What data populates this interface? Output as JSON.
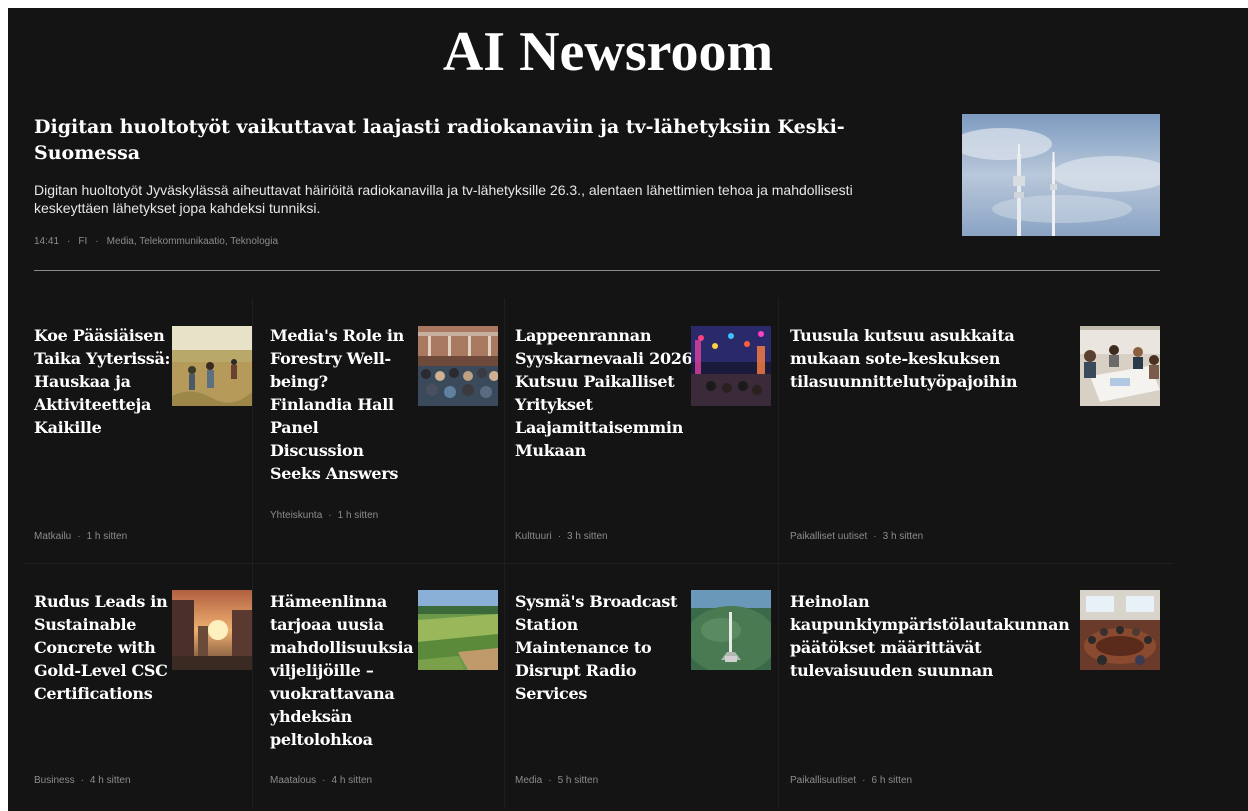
{
  "masthead": "AI Newsroom",
  "hero": {
    "title": "Digitan huoltotyöt vaikuttavat laajasti radiokanaviin ja tv-lähetyksiin Keski-Suomessa",
    "summary": "Digitan huoltotyöt Jyväskylässä aiheuttavat häiriöitä radiokanavilla ja tv-lähetyksille 26.3., alentaen lähettimien tehoa ja mahdollisesti keskeyttäen lähetykset jopa kahdeksi tunniksi.",
    "time": "14:41",
    "lang": "FI",
    "categories": "Media, Telekommunikaatio, Teknologia",
    "image": "radio-masts-photo"
  },
  "cards": [
    {
      "title": "Koe Pääsiäisen Taika Yyterissä: Hauskaa ja Aktiviteetteja Kaikille",
      "category": "Matkailu",
      "time": "1 h sitten",
      "image": "people-in-meadow-photo"
    },
    {
      "title": "Media's Role in Forestry Well-being? Finlandia Hall Panel Discussion Seeks Answers",
      "category": "Yhteiskunta",
      "time": "1 h sitten",
      "image": "audience-in-hall-photo"
    },
    {
      "title": "Lappeenrannan Syyskarnevaali 2026 Kutsuu Paikalliset Yritykset Laajamittaisemmin Mukaan",
      "category": "Kulttuuri",
      "time": "3 h sitten",
      "image": "carnival-lights-photo"
    },
    {
      "title": "Tuusula kutsuu asukkaita mukaan sote-keskuksen tilasuunnittelutyöpajoihin",
      "category": "Paikalliset uutiset",
      "time": "3 h sitten",
      "image": "workshop-table-photo"
    },
    {
      "title": "Rudus Leads in Sustainable Concrete with Gold-Level CSC Certifications",
      "category": "Business",
      "time": "4 h sitten",
      "image": "city-sunset-photo"
    },
    {
      "title": "Hämeenlinna tarjoaa uusia mahdollisuuksia viljelijöille – vuokrattavana yhdeksän peltolohkoa",
      "category": "Maatalous",
      "time": "4 h sitten",
      "image": "farm-fields-photo"
    },
    {
      "title": "Sysmä's Broadcast Station Maintenance to Disrupt Radio Services",
      "category": "Media",
      "time": "5 h sitten",
      "image": "broadcast-tower-aerial-photo"
    },
    {
      "title": "Heinolan kaupunkiympäristölautakunnan päätökset määrittävät tulevaisuuden suunnan",
      "category": "Paikallisuutiset",
      "time": "6 h sitten",
      "image": "council-meeting-photo"
    }
  ]
}
